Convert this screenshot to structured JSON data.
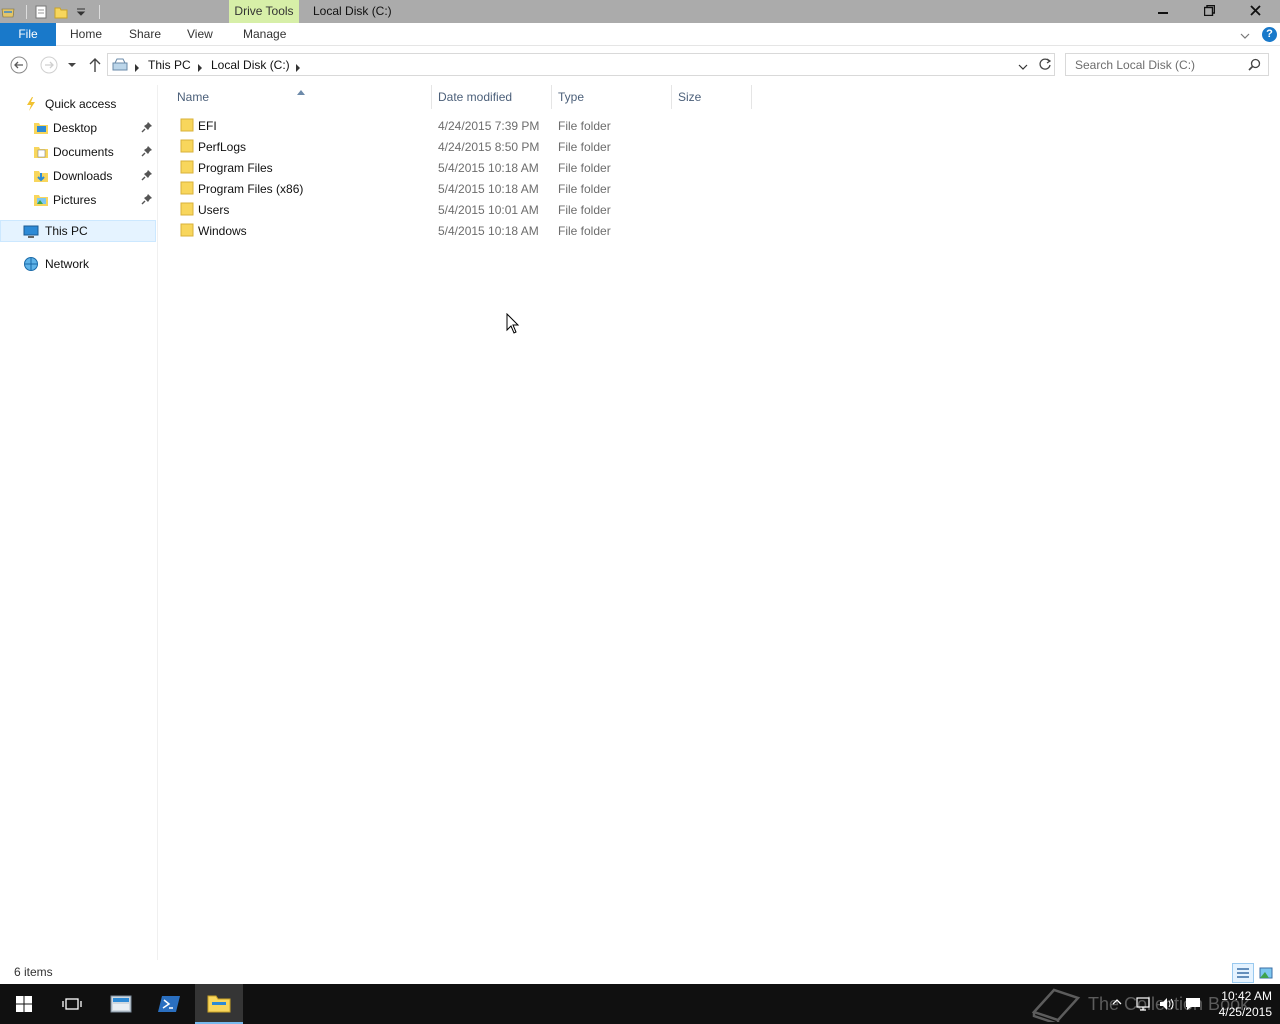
{
  "titlebar": {
    "context_tab": "Drive Tools",
    "title": "Local Disk (C:)"
  },
  "ribbon": {
    "tabs": [
      "File",
      "Home",
      "Share",
      "View",
      "Manage"
    ]
  },
  "address": {
    "crumbs": [
      "This PC",
      "Local Disk (C:)"
    ]
  },
  "search": {
    "placeholder": "Search Local Disk (C:)"
  },
  "navpane": {
    "quick_access": "Quick access",
    "pinned": [
      "Desktop",
      "Documents",
      "Downloads",
      "Pictures"
    ],
    "this_pc": "This PC",
    "network": "Network"
  },
  "columns": [
    "Name",
    "Date modified",
    "Type",
    "Size"
  ],
  "files": [
    {
      "name": "EFI",
      "date": "4/24/2015 7:39 PM",
      "type": "File folder"
    },
    {
      "name": "PerfLogs",
      "date": "4/24/2015 8:50 PM",
      "type": "File folder"
    },
    {
      "name": "Program Files",
      "date": "5/4/2015 10:18 AM",
      "type": "File folder"
    },
    {
      "name": "Program Files (x86)",
      "date": "5/4/2015 10:18 AM",
      "type": "File folder"
    },
    {
      "name": "Users",
      "date": "5/4/2015 10:01 AM",
      "type": "File folder"
    },
    {
      "name": "Windows",
      "date": "5/4/2015 10:18 AM",
      "type": "File folder"
    }
  ],
  "status": {
    "count": "6 items"
  },
  "taskbar": {
    "watermark": "The Collection Book",
    "time": "10:42 AM",
    "date": "4/25/2015"
  },
  "colors": {
    "accent": "#1979ca",
    "context_tab": "#d7efa8",
    "folder": "#f8d65c",
    "selection": "#e5f3ff"
  }
}
